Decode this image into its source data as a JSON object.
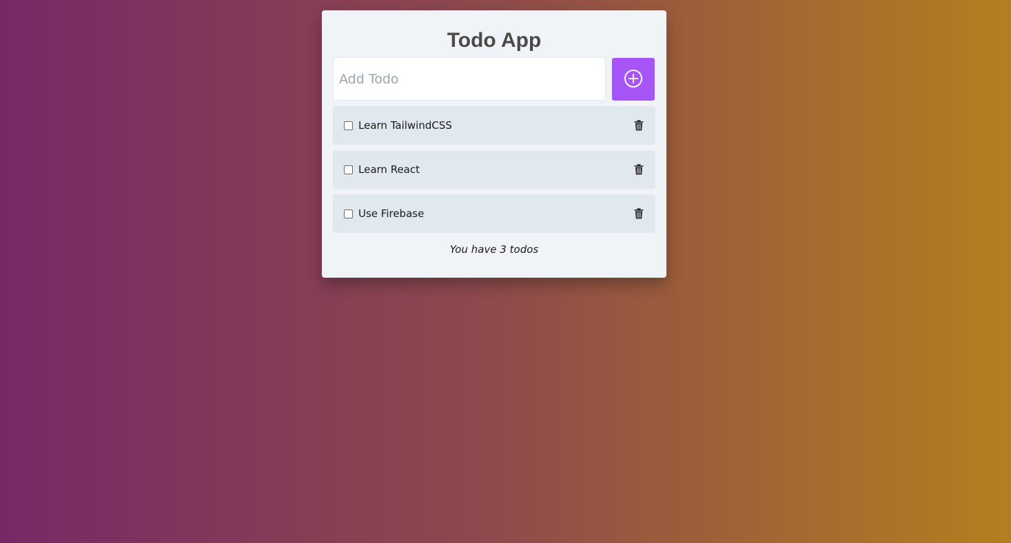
{
  "app": {
    "title": "Todo App"
  },
  "add": {
    "placeholder": "Add Todo",
    "value": "",
    "button_icon": "plus-circle-icon",
    "accent_color": "#a855f7"
  },
  "todos": [
    {
      "label": "Learn TailwindCSS",
      "completed": false,
      "delete_icon": "trash-icon"
    },
    {
      "label": "Learn React",
      "completed": false,
      "delete_icon": "trash-icon"
    },
    {
      "label": "Use Firebase",
      "completed": false,
      "delete_icon": "trash-icon"
    }
  ],
  "footer": {
    "count_text": "You have 3 todos"
  },
  "colors": {
    "background_start": "#772866",
    "background_end": "#b37f1e",
    "card": "#f0f4f8",
    "item": "#e2e8f0"
  }
}
